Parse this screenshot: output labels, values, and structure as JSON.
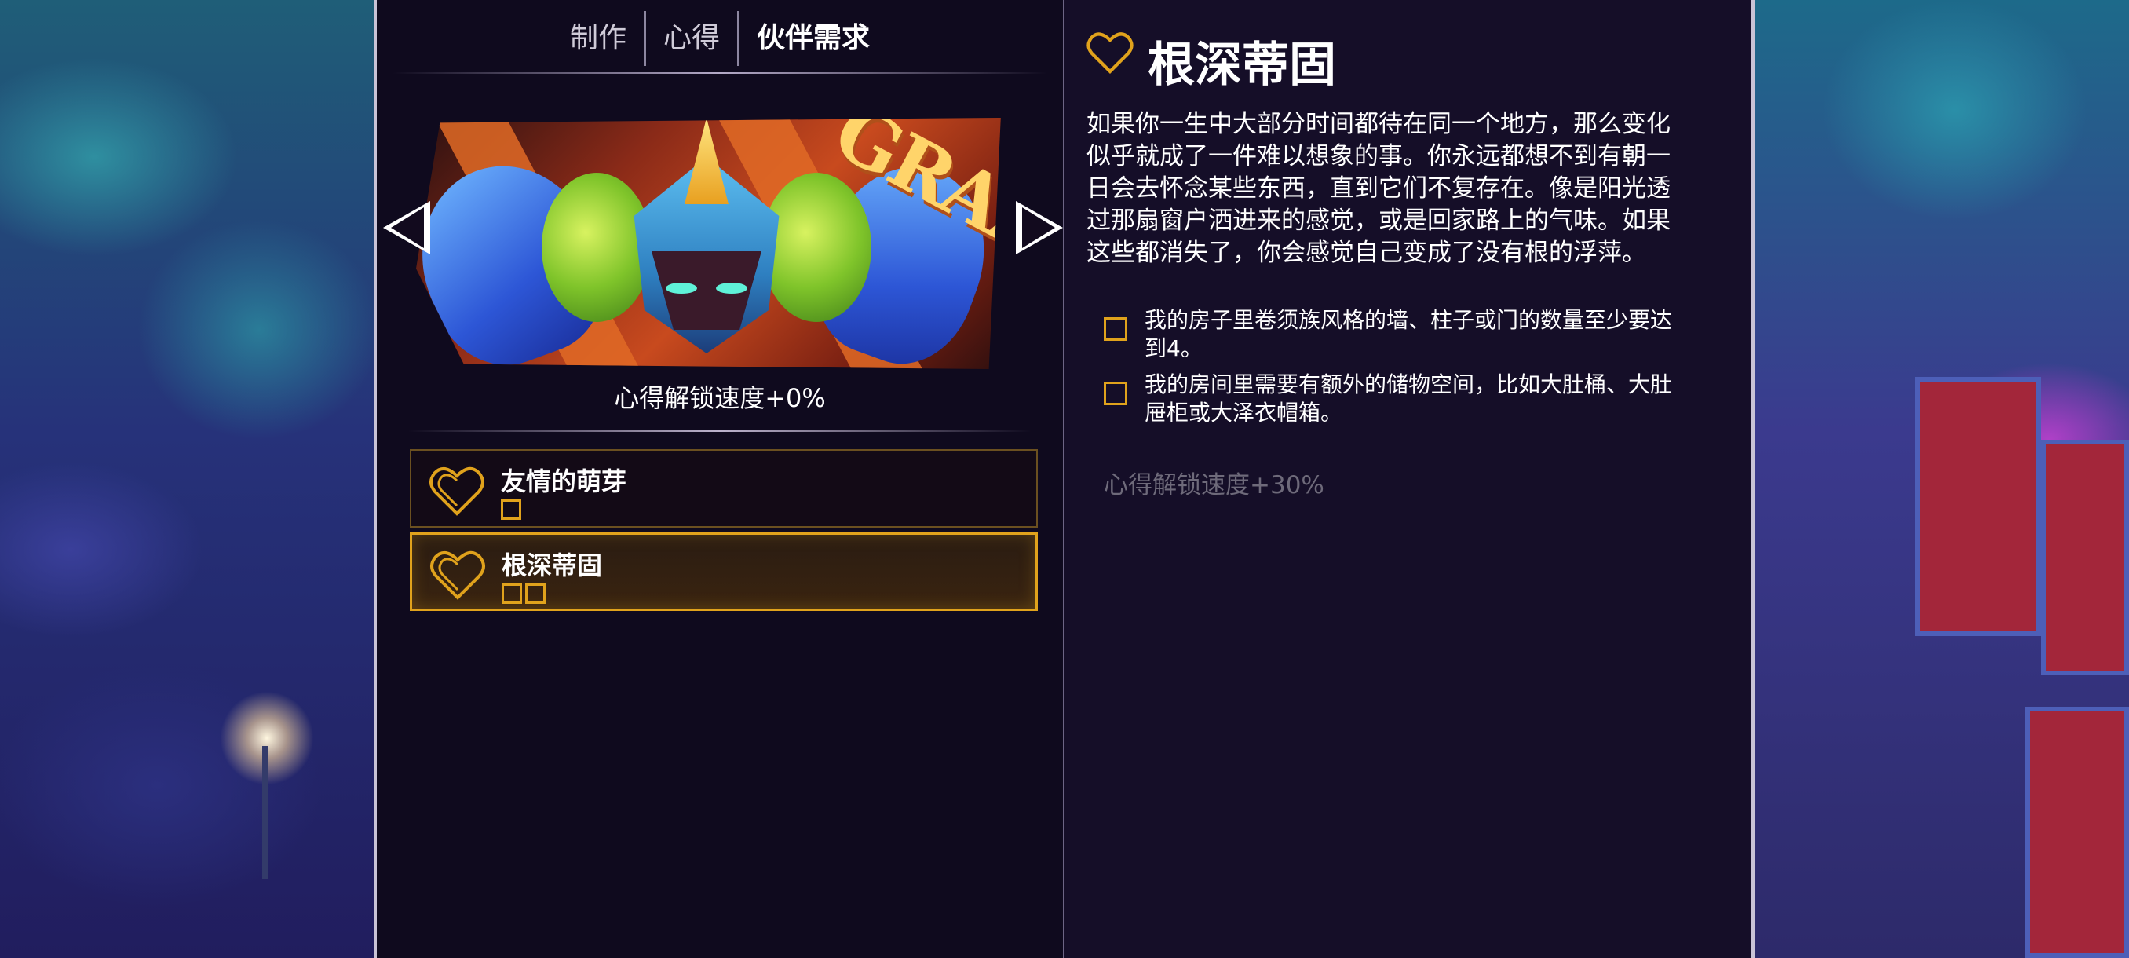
{
  "tabs": [
    {
      "label": "制作",
      "active": false
    },
    {
      "label": "心得",
      "active": false
    },
    {
      "label": "伙伴需求",
      "active": true
    }
  ],
  "banner": {
    "onomatopoeia": "GRAAA"
  },
  "companion": {
    "unlock_speed": "心得解锁速度+0%"
  },
  "insights": [
    {
      "title": "友情的萌芽",
      "progress_boxes": 1,
      "selected": false
    },
    {
      "title": "根深蒂固",
      "progress_boxes": 2,
      "selected": true
    }
  ],
  "detail": {
    "title": "根深蒂固",
    "description_lines": [
      "如果你一生中大部分时间都待在同一个地方，那么变化",
      "似乎就成了一件难以想象的事。你永远都想不到有朝一",
      "日会去怀念某些东西，直到它们不复存在。像是阳光透",
      "过那扇窗户洒进来的感觉，或是回家路上的气味。如果",
      "这些都消失了，你会感觉自己变成了没有根的浮萍。"
    ],
    "requirements": [
      {
        "lines": [
          "我的房子里卷须族风格的墙、柱子或门的数量至少要达",
          "到4。"
        ],
        "checked": false
      },
      {
        "lines": [
          "我的房间里需要有额外的储物空间，比如大肚桶、大肚",
          "屉柜或大泽衣帽箱。"
        ],
        "checked": false
      }
    ],
    "bonus": "心得解锁速度+30%"
  },
  "colors": {
    "accent_gold": "#e0a21c",
    "panel_bg": "#120a1e",
    "muted_text": "#6e6a7a"
  },
  "icons": {
    "insight": "heart-outline-icon",
    "prev": "triangle-left-icon",
    "next": "triangle-right-icon",
    "checkbox": "empty-square-icon"
  }
}
